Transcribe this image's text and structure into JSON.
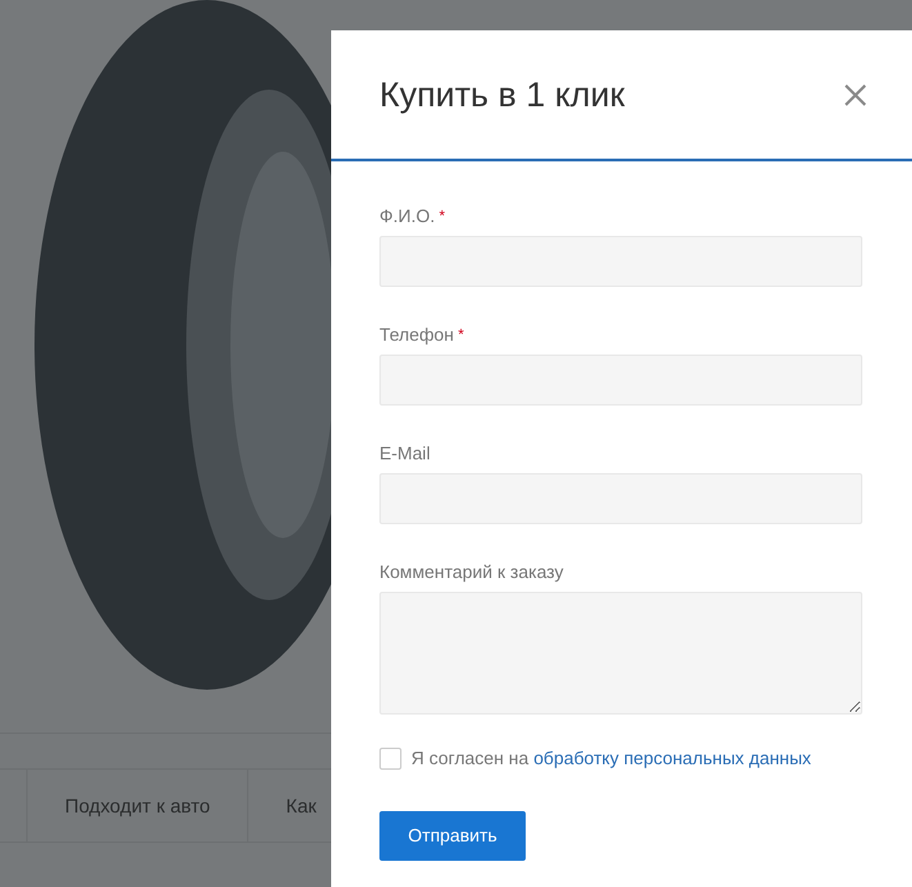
{
  "background_tabs": [
    {
      "label": "Подходит к авто"
    },
    {
      "label": "Как"
    }
  ],
  "modal": {
    "title": "Купить в 1 клик",
    "fields": [
      {
        "kind": "input",
        "label": "Ф.И.О.",
        "required_mark": "*"
      },
      {
        "kind": "input",
        "label": "Телефон",
        "required_mark": "*"
      },
      {
        "kind": "input",
        "label": "E-Mail"
      },
      {
        "kind": "textarea",
        "label": "Комментарий к заказу"
      }
    ],
    "consent": {
      "text": "Я согласен на",
      "link": "обработку персональных данных",
      "checked": false
    },
    "submit": "Отправить"
  }
}
